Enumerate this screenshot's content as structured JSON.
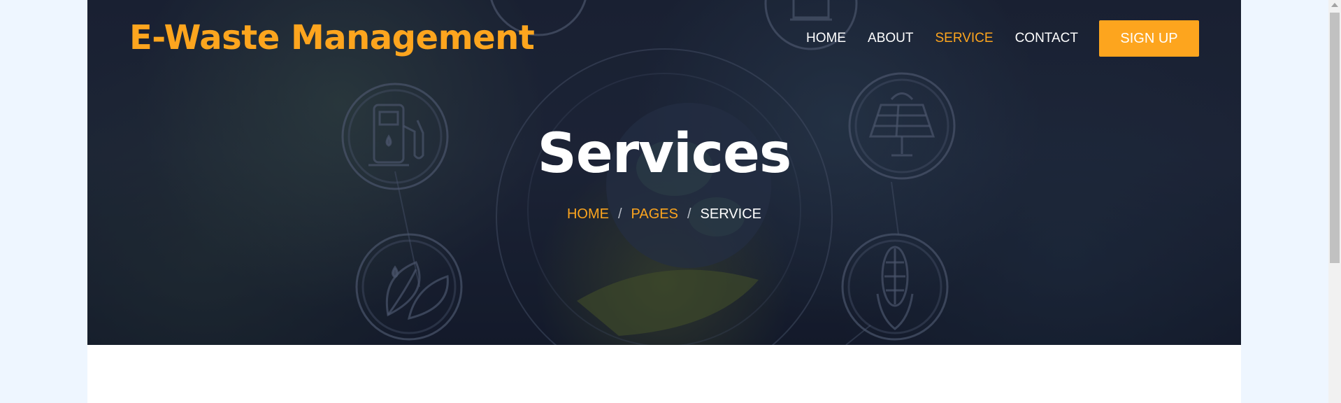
{
  "header": {
    "logo_text": "E-Waste Management",
    "nav": [
      {
        "label": "HOME",
        "active": false
      },
      {
        "label": "ABOUT",
        "active": false
      },
      {
        "label": "SERVICE",
        "active": true
      },
      {
        "label": "CONTACT",
        "active": false
      }
    ],
    "signup_label": "SIGN UP"
  },
  "hero": {
    "title": "Services",
    "breadcrumb": {
      "items": [
        "HOME",
        "PAGES"
      ],
      "separator": "/",
      "current": "SERVICE"
    }
  },
  "colors": {
    "accent": "#fda51e",
    "hero_bg": "#1e2638",
    "page_bg": "#eef6ff",
    "text_light": "#ffffff"
  },
  "icons": [
    "fuel-pump-icon",
    "solar-panel-icon",
    "leaf-drop-icon",
    "corn-icon",
    "wind-turbine-icon",
    "earth-globe-icon"
  ]
}
